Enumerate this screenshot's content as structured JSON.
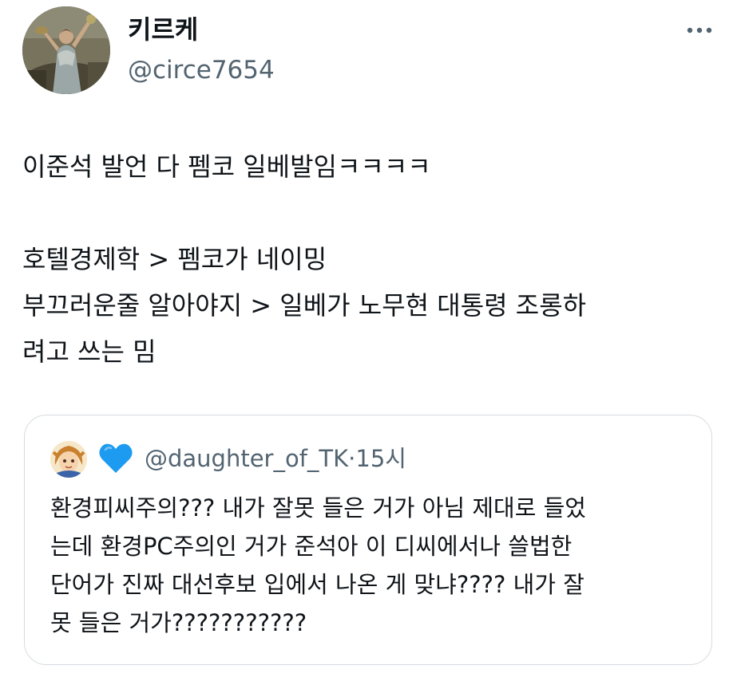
{
  "tweet": {
    "display_name": "키르케",
    "handle": "@circe7654",
    "more_icon": "more-horizontal-icon",
    "text_lines": [
      "이준석 발언 다 펨코 일베발임ㅋㅋㅋㅋ",
      "",
      "호텔경제학 > 펨코가 네이밍",
      "부끄러운줄 알아야지 > 일베가 노무현 대통령 조롱하",
      "려고 쓰는 밈"
    ]
  },
  "quoted_tweet": {
    "badge_icon": "blue-heart-icon",
    "handle": "@daughter_of_TK",
    "separator": "·",
    "time": "15시",
    "text_lines": [
      "환경피씨주의??? 내가 잘못 들은 거가 아님 제대로 들었",
      "는데 환경PC주의인 거가 준석아 이 디씨에서나 쓸법한",
      "단어가 진짜 대선후보 입에서 나온 게 맞냐???? 내가 잘",
      "못 들은 거가???????????"
    ]
  },
  "colors": {
    "text": "#0f1419",
    "secondary": "#536471",
    "border": "#d5dce1",
    "heart": "#1d9bf0"
  }
}
